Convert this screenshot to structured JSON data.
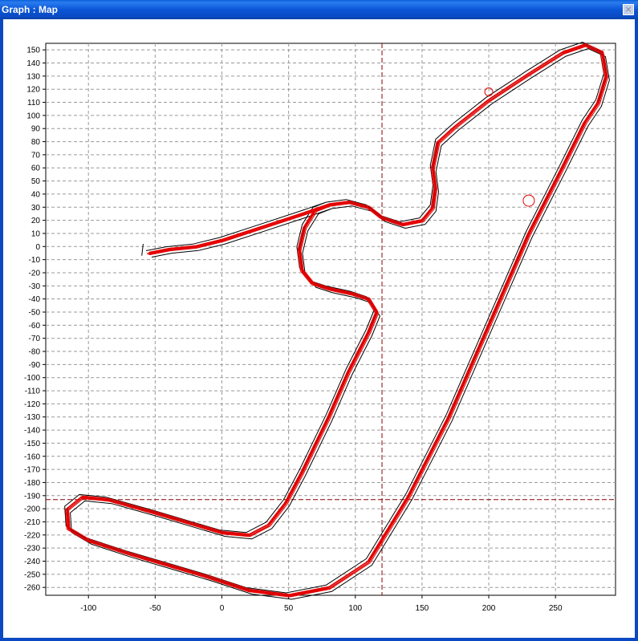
{
  "window": {
    "title": "Graph : Map",
    "close_label": "×"
  },
  "colors": {
    "lap_red": "#e60000",
    "lap_black": "#000000",
    "grid": "#9a9a9a",
    "cursor": "#8b0000"
  },
  "chart_data": {
    "type": "line",
    "title": "",
    "xlabel": "",
    "ylabel": "",
    "xlim": [
      -132,
      295
    ],
    "ylim": [
      -266,
      155
    ],
    "xticks": [
      -100,
      -50,
      0,
      50,
      100,
      150,
      200,
      250
    ],
    "yticks": [
      150,
      140,
      130,
      120,
      110,
      100,
      90,
      80,
      70,
      60,
      50,
      40,
      30,
      20,
      10,
      0,
      -10,
      -20,
      -30,
      -40,
      -50,
      -60,
      -70,
      -80,
      -90,
      -100,
      -110,
      -120,
      -130,
      -140,
      -150,
      -160,
      -170,
      -180,
      -190,
      -200,
      -210,
      -220,
      -230,
      -240,
      -250,
      -260
    ],
    "grid": true,
    "cursor": {
      "x": 120,
      "y": -193
    },
    "track": [
      [
        -55,
        -5
      ],
      [
        -40,
        -2
      ],
      [
        -20,
        0
      ],
      [
        0,
        5
      ],
      [
        30,
        15
      ],
      [
        60,
        25
      ],
      [
        80,
        32
      ],
      [
        95,
        34
      ],
      [
        110,
        30
      ],
      [
        120,
        22
      ],
      [
        135,
        17
      ],
      [
        150,
        20
      ],
      [
        158,
        30
      ],
      [
        160,
        45
      ],
      [
        158,
        60
      ],
      [
        162,
        80
      ],
      [
        175,
        92
      ],
      [
        200,
        112
      ],
      [
        230,
        132
      ],
      [
        255,
        148
      ],
      [
        272,
        154
      ],
      [
        285,
        148
      ],
      [
        288,
        130
      ],
      [
        282,
        110
      ],
      [
        272,
        95
      ],
      [
        255,
        60
      ],
      [
        230,
        10
      ],
      [
        200,
        -60
      ],
      [
        170,
        -130
      ],
      [
        140,
        -190
      ],
      [
        110,
        -240
      ],
      [
        80,
        -260
      ],
      [
        50,
        -266
      ],
      [
        20,
        -262
      ],
      [
        -10,
        -252
      ],
      [
        -40,
        -243
      ],
      [
        -70,
        -234
      ],
      [
        -100,
        -224
      ],
      [
        -115,
        -215
      ],
      [
        -116,
        -200
      ],
      [
        -105,
        -191
      ],
      [
        -85,
        -193
      ],
      [
        -50,
        -203
      ],
      [
        -20,
        -212
      ],
      [
        0,
        -218
      ],
      [
        20,
        -220
      ],
      [
        35,
        -212
      ],
      [
        48,
        -195
      ],
      [
        60,
        -172
      ],
      [
        80,
        -130
      ],
      [
        95,
        -95
      ],
      [
        110,
        -65
      ],
      [
        116,
        -50
      ],
      [
        110,
        -40
      ],
      [
        98,
        -36
      ],
      [
        80,
        -32
      ],
      [
        68,
        -28
      ],
      [
        60,
        -18
      ],
      [
        58,
        -2
      ],
      [
        62,
        15
      ],
      [
        70,
        28
      ],
      [
        80,
        32
      ]
    ],
    "pit_stub": [
      [
        -60,
        -7
      ],
      [
        -59,
        2
      ]
    ],
    "start_spot": {
      "x": 230,
      "y": 35
    },
    "apex_marker": {
      "x": 200,
      "y": 118
    }
  }
}
